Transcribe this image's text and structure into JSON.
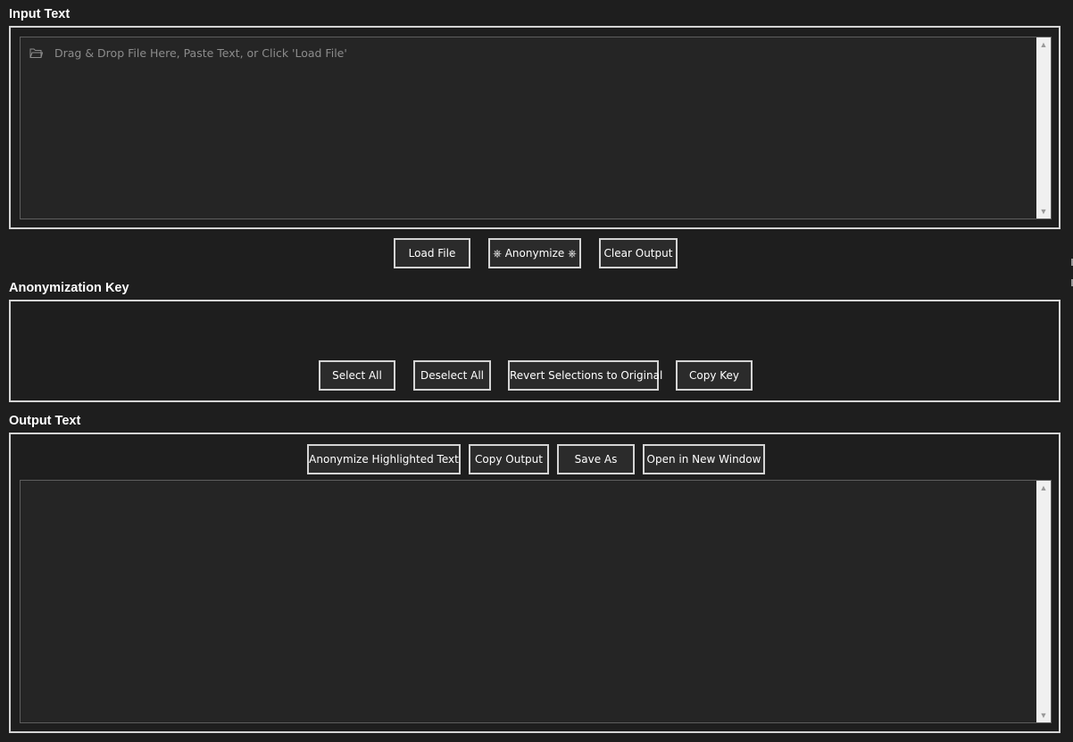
{
  "input_section": {
    "title": "Input Text",
    "placeholder": "Drag & Drop File Here, Paste Text, or Click 'Load File'",
    "icon": "folder-icon"
  },
  "actions": {
    "load_file": "Load File",
    "anonymize": "⎈ Anonymize ⎈",
    "clear_output": "Clear Output"
  },
  "key_section": {
    "title": "Anonymization Key",
    "select_all": "Select All",
    "deselect_all": "Deselect All",
    "revert": "Revert Selections to Original",
    "copy_key": "Copy Key"
  },
  "output_section": {
    "title": "Output Text",
    "anonymize_highlighted": "Anonymize Highlighted Text",
    "copy_output": "Copy Output",
    "save_as": "Save As",
    "open_new_window": "Open in New Window"
  },
  "colors": {
    "background": "#1e1e1e",
    "textarea": "#252525",
    "border": "#d4d4d4",
    "placeholder": "#8c8c8c"
  }
}
